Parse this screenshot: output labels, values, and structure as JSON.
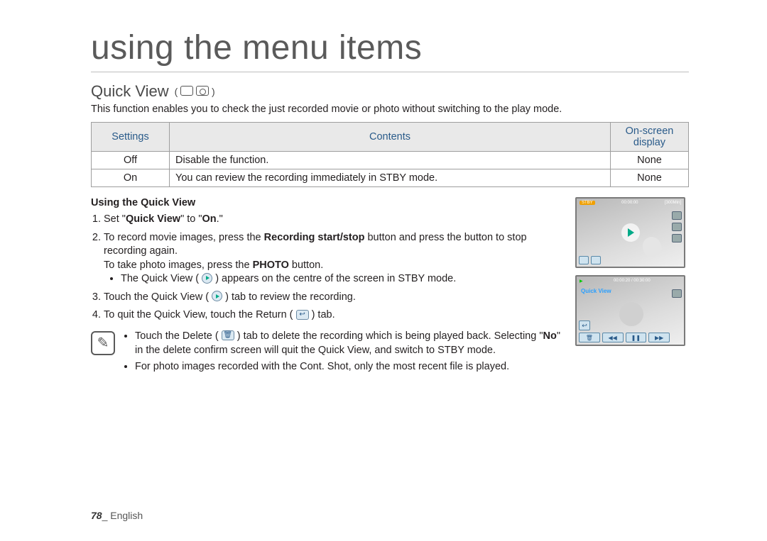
{
  "page_title": "using the menu items",
  "section": {
    "title": "Quick View",
    "intro": "This function enables you to check the just recorded movie or photo without switching to the play mode."
  },
  "table": {
    "headers": {
      "settings": "Settings",
      "contents": "Contents",
      "display": "On-screen display"
    },
    "rows": [
      {
        "setting": "Off",
        "content": "Disable the function.",
        "display": "None"
      },
      {
        "setting": "On",
        "content": "You can review the recording immediately in STBY mode.",
        "display": "None"
      }
    ]
  },
  "steps_title": "Using the Quick View",
  "steps": {
    "s1_a": "Set \"",
    "s1_b": "Quick View",
    "s1_c": "\" to \"",
    "s1_d": "On",
    "s1_e": ".\"",
    "s2_a": "To record movie images, press the ",
    "s2_b": "Recording start/stop",
    "s2_c": " button and press the button to stop recording again.",
    "s2_d": "To take photo images, press the ",
    "s2_e": "PHOTO",
    "s2_f": " button.",
    "s2_bullet": "The Quick View ( ",
    "s2_bullet_end": " ) appears on the centre of the screen in STBY mode.",
    "s3_a": "Touch the Quick View ( ",
    "s3_b": " ) tab to review the recording.",
    "s4_a": "To quit the Quick View, touch the Return ( ",
    "s4_b": " ) tab."
  },
  "notes": {
    "n1_a": "Touch the Delete ( ",
    "n1_b": " ) tab to delete the recording which is being played back. Selecting \"",
    "n1_c": "No",
    "n1_d": "\" in the delete confirm screen will quit the Quick View, and switch to STBY mode.",
    "n2": "For photo images recorded with the Cont. Shot, only the most recent file is played."
  },
  "screens": {
    "stby_label": "STBY",
    "time": "00:00:00",
    "mem": "[300Min]",
    "qv_label": "Quick View",
    "counter": "00:00:20 / 00:30:00"
  },
  "footer": {
    "page": "78",
    "sep": "_ ",
    "lang": "English"
  }
}
